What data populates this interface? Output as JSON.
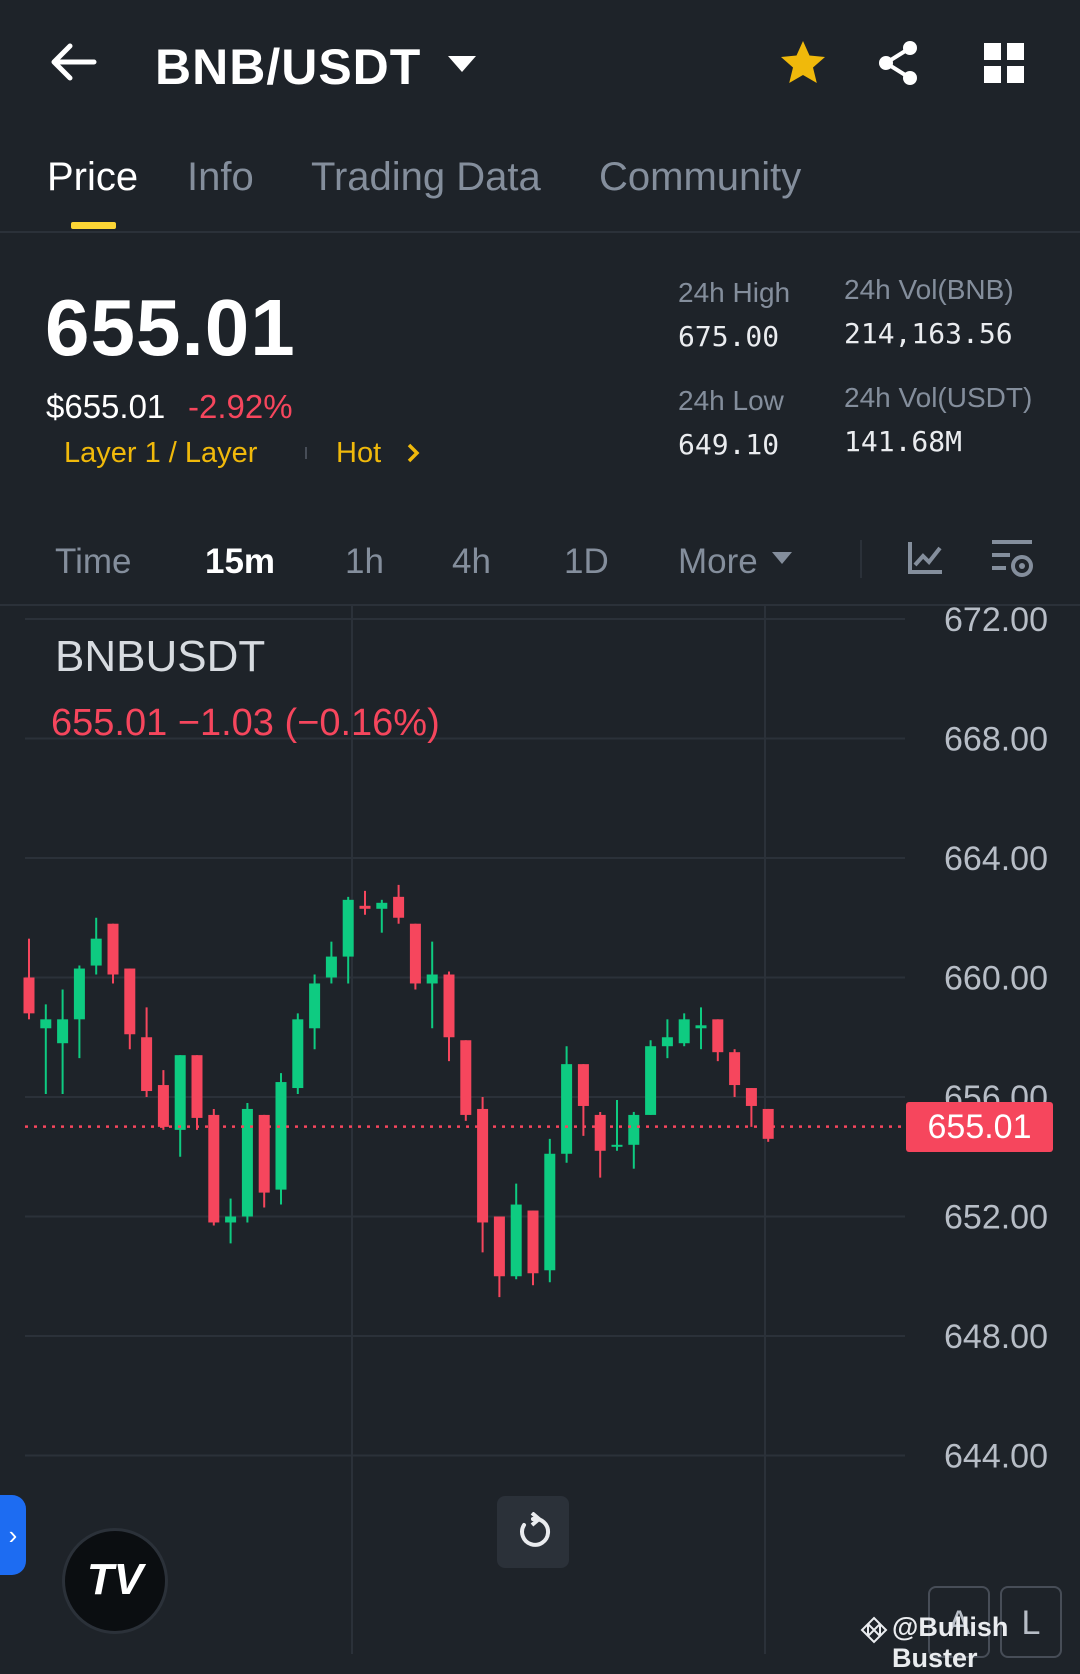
{
  "header": {
    "pair": "BNB/USDT",
    "icons": [
      "back-arrow-icon",
      "star-icon",
      "share-icon",
      "grid-icon"
    ],
    "colors": {
      "star": "#f0b90b",
      "accent": "#fcd535"
    }
  },
  "tabs": [
    {
      "label": "Price",
      "active": true
    },
    {
      "label": "Info",
      "active": false
    },
    {
      "label": "Trading Data",
      "active": false
    },
    {
      "label": "Community",
      "active": false
    }
  ],
  "summary": {
    "last_price": "655.01",
    "usd_price": "$655.01",
    "change_pct": "-2.92%",
    "tag_category": "Layer 1 / Layer",
    "tag_hot": "Hot",
    "high_label": "24h High",
    "high_value": "675.00",
    "low_label": "24h Low",
    "low_value": "649.10",
    "vol_base_label": "24h Vol(BNB)",
    "vol_base_value": "214,163.56",
    "vol_quote_label": "24h Vol(USDT)",
    "vol_quote_value": "141.68M",
    "colors": {
      "down": "#f6465d",
      "up": "#0ecb81"
    }
  },
  "intervals": {
    "items": [
      "Time",
      "15m",
      "1h",
      "4h",
      "1D",
      "More"
    ],
    "active": "15m"
  },
  "chart": {
    "symbol": "BNBUSDT",
    "legend": "655.01 −1.03 (−0.16%)",
    "current_price_tag": "655.01",
    "y_labels": [
      "672.00",
      "668.00",
      "664.00",
      "660.00",
      "656.00",
      "652.00",
      "648.00",
      "644.00"
    ]
  },
  "controls": {
    "tv_logo": "TV",
    "side_handle": "›",
    "mini_a": "A",
    "mini_l": "L"
  },
  "watermark": "@Bullish Buster",
  "chart_data": {
    "type": "candlestick",
    "interval": "15m",
    "ylim": [
      643,
      673
    ],
    "current_price": 655.01,
    "candles": [
      {
        "o": 660,
        "c": 658.8,
        "h": 661.3,
        "l": 658.6
      },
      {
        "o": 658.3,
        "c": 658.6,
        "h": 659.1,
        "l": 656.1
      },
      {
        "o": 657.8,
        "c": 658.6,
        "h": 659.6,
        "l": 656.1
      },
      {
        "o": 658.6,
        "c": 660.3,
        "h": 660.4,
        "l": 657.3
      },
      {
        "o": 660.4,
        "c": 661.3,
        "h": 662.0,
        "l": 660.1
      },
      {
        "o": 661.8,
        "c": 660.1,
        "h": 661.8,
        "l": 659.8
      },
      {
        "o": 660.3,
        "c": 658.1,
        "h": 660.3,
        "l": 657.6
      },
      {
        "o": 658.0,
        "c": 656.2,
        "h": 659.0,
        "l": 656.0
      },
      {
        "o": 656.4,
        "c": 655.0,
        "h": 656.9,
        "l": 654.9
      },
      {
        "o": 654.9,
        "c": 657.4,
        "h": 657.4,
        "l": 654.0
      },
      {
        "o": 657.4,
        "c": 655.3,
        "h": 657.4,
        "l": 654.9
      },
      {
        "o": 655.4,
        "c": 651.8,
        "h": 655.6,
        "l": 651.7
      },
      {
        "o": 651.8,
        "c": 652.0,
        "h": 652.6,
        "l": 651.1
      },
      {
        "o": 652.0,
        "c": 655.6,
        "h": 655.8,
        "l": 651.8
      },
      {
        "o": 655.4,
        "c": 652.8,
        "h": 655.4,
        "l": 652.3
      },
      {
        "o": 652.9,
        "c": 656.5,
        "h": 656.8,
        "l": 652.4
      },
      {
        "o": 656.3,
        "c": 658.6,
        "h": 658.8,
        "l": 656.1
      },
      {
        "o": 658.3,
        "c": 659.8,
        "h": 660.1,
        "l": 657.6
      },
      {
        "o": 660.0,
        "c": 660.7,
        "h": 661.2,
        "l": 659.8
      },
      {
        "o": 660.7,
        "c": 662.6,
        "h": 662.7,
        "l": 659.8
      },
      {
        "o": 662.4,
        "c": 662.3,
        "h": 662.9,
        "l": 662.1
      },
      {
        "o": 662.3,
        "c": 662.5,
        "h": 662.6,
        "l": 661.5
      },
      {
        "o": 662.7,
        "c": 662.0,
        "h": 663.1,
        "l": 661.8
      },
      {
        "o": 661.8,
        "c": 659.8,
        "h": 661.8,
        "l": 659.6
      },
      {
        "o": 659.8,
        "c": 660.1,
        "h": 661.2,
        "l": 658.3
      },
      {
        "o": 660.1,
        "c": 658.0,
        "h": 660.2,
        "l": 657.2
      },
      {
        "o": 657.9,
        "c": 655.4,
        "h": 657.9,
        "l": 655.2
      },
      {
        "o": 655.6,
        "c": 651.8,
        "h": 656.0,
        "l": 650.8
      },
      {
        "o": 652.0,
        "c": 650.0,
        "h": 652.0,
        "l": 649.3
      },
      {
        "o": 650.0,
        "c": 652.4,
        "h": 653.1,
        "l": 649.9
      },
      {
        "o": 652.2,
        "c": 650.1,
        "h": 652.2,
        "l": 649.7
      },
      {
        "o": 650.2,
        "c": 654.1,
        "h": 654.6,
        "l": 649.8
      },
      {
        "o": 654.1,
        "c": 657.1,
        "h": 657.7,
        "l": 653.8
      },
      {
        "o": 657.1,
        "c": 655.7,
        "h": 657.1,
        "l": 654.7
      },
      {
        "o": 655.4,
        "c": 654.2,
        "h": 655.5,
        "l": 653.3
      },
      {
        "o": 654.4,
        "c": 654.4,
        "h": 655.9,
        "l": 654.2
      },
      {
        "o": 654.4,
        "c": 655.4,
        "h": 655.5,
        "l": 653.6
      },
      {
        "o": 655.4,
        "c": 657.7,
        "h": 657.9,
        "l": 655.4
      },
      {
        "o": 657.7,
        "c": 658.0,
        "h": 658.6,
        "l": 657.3
      },
      {
        "o": 657.8,
        "c": 658.6,
        "h": 658.8,
        "l": 657.7
      },
      {
        "o": 658.3,
        "c": 658.4,
        "h": 659.0,
        "l": 657.6
      },
      {
        "o": 658.6,
        "c": 657.5,
        "h": 658.6,
        "l": 657.2
      },
      {
        "o": 657.5,
        "c": 656.4,
        "h": 657.6,
        "l": 656.0
      },
      {
        "o": 656.3,
        "c": 655.7,
        "h": 656.3,
        "l": 655.0
      },
      {
        "o": 655.6,
        "c": 654.6,
        "h": 655.6,
        "l": 654.5
      }
    ]
  }
}
